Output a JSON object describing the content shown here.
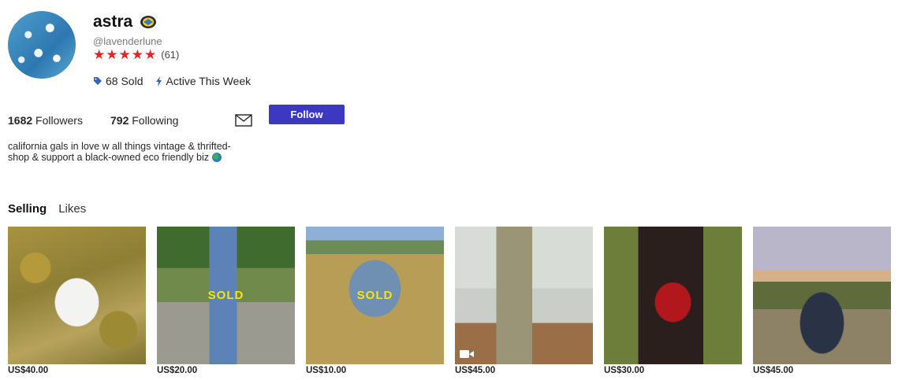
{
  "profile": {
    "name": "astra",
    "handle": "@lavenderlune",
    "rating_stars": 5,
    "rating_count": "(61)",
    "sold": "68 Sold",
    "activity": "Active This Week",
    "followers_count": "1682",
    "followers_label": "Followers",
    "following_count": "792",
    "following_label": "Following",
    "follow_button": "Follow",
    "bio": "california gals in love w all things vintage & thrifted- shop & support a black-owned eco friendly biz"
  },
  "icons": {
    "badge": "verified-badge-icon",
    "tag": "tag-icon",
    "bolt": "lightning-icon",
    "mail": "mail-icon",
    "globe": "globe-emoji-icon",
    "video": "video-icon"
  },
  "colors": {
    "accent": "#3d38c1",
    "star": "#e6231f",
    "sold_text": "#f7e600"
  },
  "tabs": [
    {
      "label": "Selling",
      "active": true
    },
    {
      "label": "Likes",
      "active": false
    }
  ],
  "listings": [
    {
      "price": "US$40.00",
      "sold_label": "",
      "has_video": false
    },
    {
      "price": "US$20.00",
      "sold_label": "SOLD",
      "has_video": false
    },
    {
      "price": "US$10.00",
      "sold_label": "SOLD",
      "has_video": false
    },
    {
      "price": "US$45.00",
      "sold_label": "",
      "has_video": true
    },
    {
      "price": "US$30.00",
      "sold_label": "",
      "has_video": false
    },
    {
      "price": "US$45.00",
      "sold_label": "",
      "has_video": false
    }
  ]
}
